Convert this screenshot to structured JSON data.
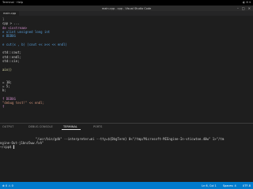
{
  "system_bar": {
    "workspace": "Terminal · Help",
    "clock": "",
    "tray": "◐ ✉ ▾"
  },
  "window": {
    "title": "main.cpp - cpp - Visual Studio Code",
    "tab_label": "main.cpp"
  },
  "editor": {
    "lines": [
      {
        "text": "1",
        "color": "#858585"
      },
      {
        "text": "cpp > ...",
        "color": "#cccccc"
      },
      {
        "text": "de <iostream>",
        "color": "#c586c0"
      },
      {
        "text": "e ulint unsigned long int",
        "color": "#569cd6"
      },
      {
        "text": "e DEBUG",
        "color": "#569cd6"
      },
      {
        "text": "",
        "color": "#d4d4d4"
      },
      {
        "text": "e cut(x , b) (cout << x<< << endl)",
        "color": "#569cd6"
      },
      {
        "text": "",
        "color": "#d4d4d4"
      },
      {
        "text": "std::cout;",
        "color": "#d4d4d4"
      },
      {
        "text": "std::endl;",
        "color": "#d4d4d4"
      },
      {
        "text": "std::cin;",
        "color": "#d4d4d4"
      },
      {
        "text": "",
        "color": "#d4d4d4"
      },
      {
        "text": "ain()",
        "color": "#dcdcaa"
      },
      {
        "text": "",
        "color": "#d4d4d4"
      },
      {
        "text": "",
        "color": "#d4d4d4"
      },
      {
        "text": "= 10;",
        "color": "#d4d4d4"
      },
      {
        "text": "= 5;",
        "color": "#d4d4d4"
      },
      {
        "text": "b;",
        "color": "#d4d4d4"
      },
      {
        "text": "",
        "color": "#d4d4d4"
      },
      {
        "text": "f DEBUG",
        "color": "#c586c0"
      },
      {
        "text": "\"debug test!\" << endl;",
        "color": "#ce9178"
      },
      {
        "text": "f",
        "color": "#c586c0"
      }
    ]
  },
  "panel": {
    "tabs": [
      {
        "label": "OUTPUT",
        "active": false
      },
      {
        "label": "DEBUG CONSOLE",
        "active": false
      },
      {
        "label": "TERMINAL",
        "active": true
      },
      {
        "label": "PORTS",
        "active": false
      }
    ]
  },
  "terminal": {
    "lines": [
      "  \"/usr/bin/gdb\" --interpreter=mi --tty=${DbgTerm} 0<\"/tmp/Microsoft-MIEngine-In-vticwtoe.40w\" 1>\"/tm",
      "ngine-Out-j1bnz5ww.fxh\"",
      "~/cpp$ ▌"
    ]
  },
  "statusbar": {
    "left": "⊗ 0  ⚠ 0",
    "position": "Ln 6, Col 1",
    "spaces": "Spaces: 4",
    "encoding": "UTF-8"
  }
}
